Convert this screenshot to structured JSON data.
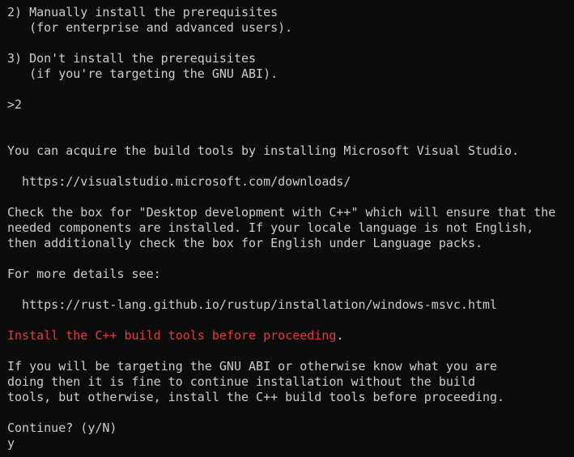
{
  "terminal": {
    "lines": [
      "2) Manually install the prerequisites",
      "   (for enterprise and advanced users).",
      "",
      "3) Don't install the prerequisites",
      "   (if you're targeting the GNU ABI).",
      "",
      ">2",
      "",
      "",
      "You can acquire the build tools by installing Microsoft Visual Studio.",
      "",
      "  https://visualstudio.microsoft.com/downloads/",
      "",
      "Check the box for \"Desktop development with C++\" which will ensure that the",
      "needed components are installed. If your locale language is not English,",
      "then additionally check the box for English under Language packs.",
      "",
      "For more details see:",
      "",
      "  https://rust-lang.github.io/rustup/installation/windows-msvc.html",
      "",
      "",
      "",
      "If you will be targeting the GNU ABI or otherwise know what you are",
      "doing then it is fine to continue installation without the build",
      "tools, but otherwise, install the C++ build tools before proceeding.",
      "",
      "Continue? (y/N)",
      "y"
    ],
    "warning_text": "Install the C++ build tools before proceeding",
    "warning_period": ".",
    "colors": {
      "background": "#0c0c0c",
      "foreground": "#cccccc",
      "warning": "#e03c3c"
    }
  }
}
